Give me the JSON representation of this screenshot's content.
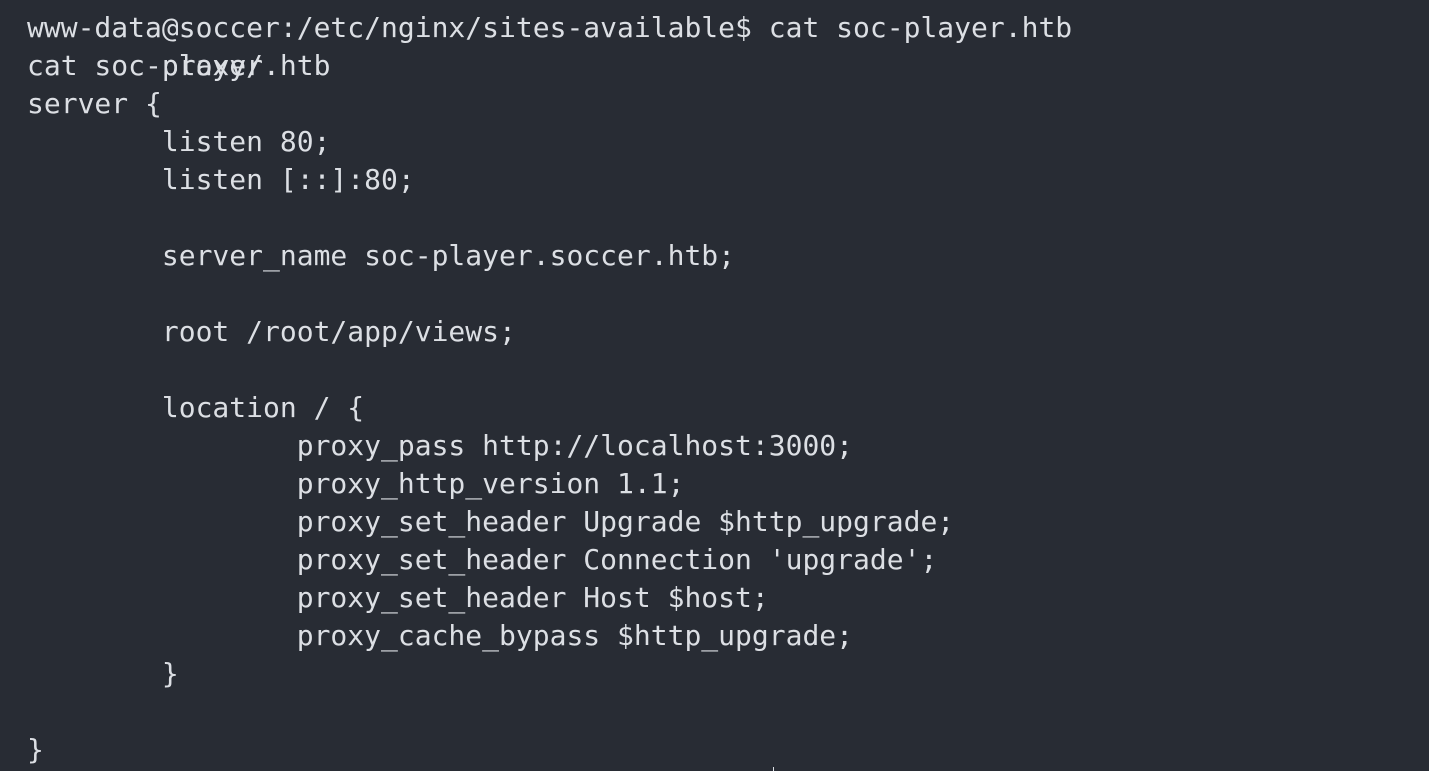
{
  "terminal": {
    "partial_top_line": "        proxy/",
    "lines": [
      "www-data@soccer:/etc/nginx/sites-available$ cat soc-player.htb",
      "cat soc-player.htb",
      "server {",
      "        listen 80;",
      "        listen [::]:80;",
      "",
      "        server_name soc-player.soccer.htb;",
      "",
      "        root /root/app/views;",
      "",
      "        location / {",
      "                proxy_pass http://localhost:3000;",
      "                proxy_http_version 1.1;",
      "                proxy_set_header Upgrade $http_upgrade;",
      "                proxy_set_header Connection 'upgrade';",
      "                proxy_set_header Host $host;",
      "                proxy_cache_bypass $http_upgrade;",
      "        }",
      "",
      "}"
    ]
  }
}
